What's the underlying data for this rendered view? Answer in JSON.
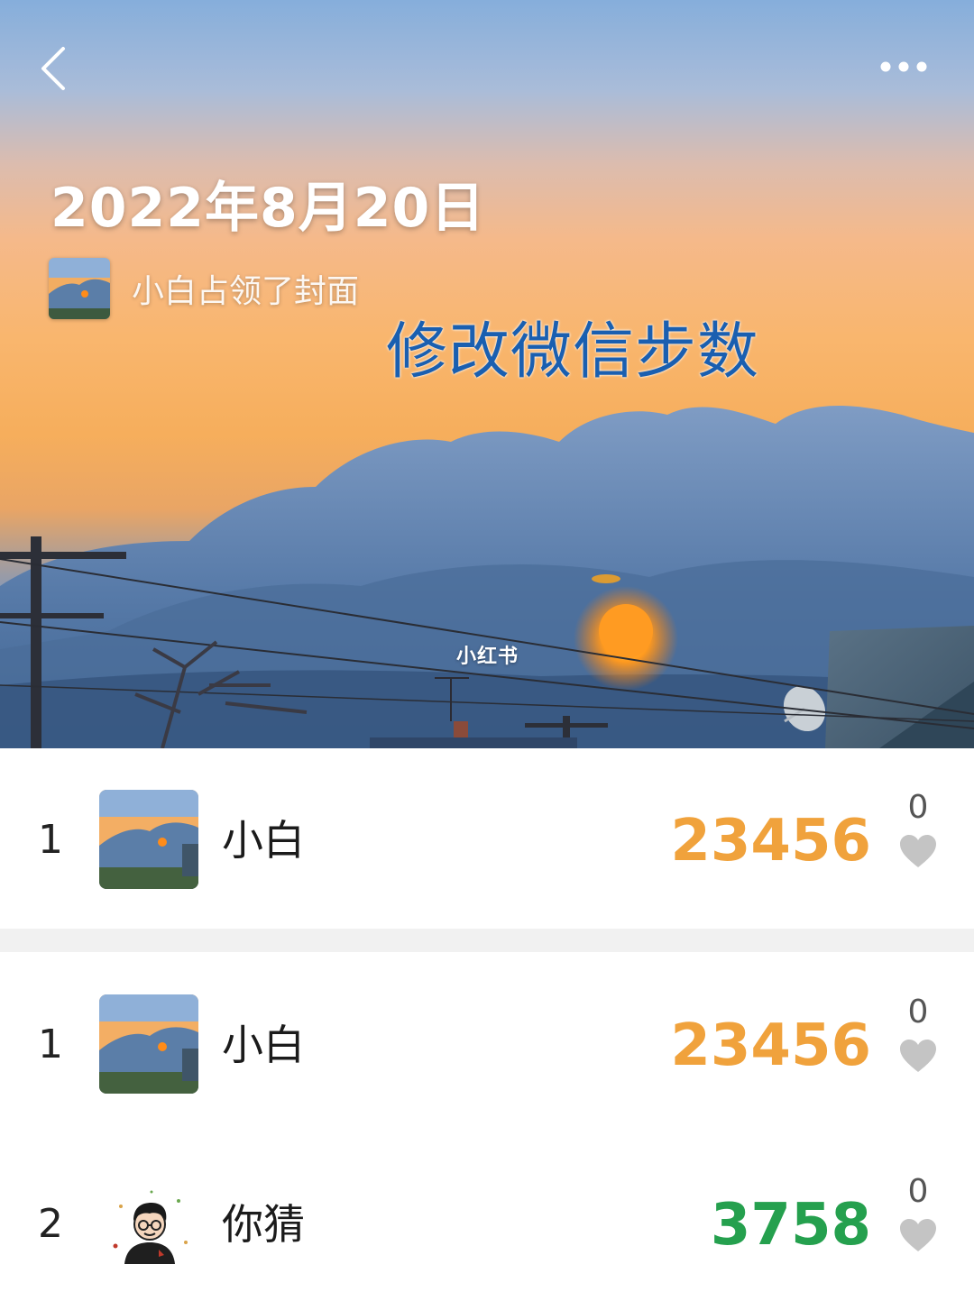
{
  "header": {
    "back_icon": "chevron-left-icon",
    "more_icon": "more-dots-icon"
  },
  "cover": {
    "date": "2022年8月20日",
    "owner_text": "小白占领了封面",
    "overlay_caption": "修改微信步数",
    "watermark": "小红书"
  },
  "my_entry": {
    "rank": "1",
    "name": "小白",
    "steps": "23456",
    "likes": "0",
    "steps_color": "#f0a23c"
  },
  "ranking": [
    {
      "rank": "1",
      "name": "小白",
      "steps": "23456",
      "likes": "0",
      "steps_color": "#f0a23c"
    },
    {
      "rank": "2",
      "name": "你猜",
      "steps": "3758",
      "likes": "0",
      "steps_color": "#25a04e"
    }
  ],
  "colors": {
    "heart": "#c4c4c4",
    "caption": "#1a5fb0"
  }
}
